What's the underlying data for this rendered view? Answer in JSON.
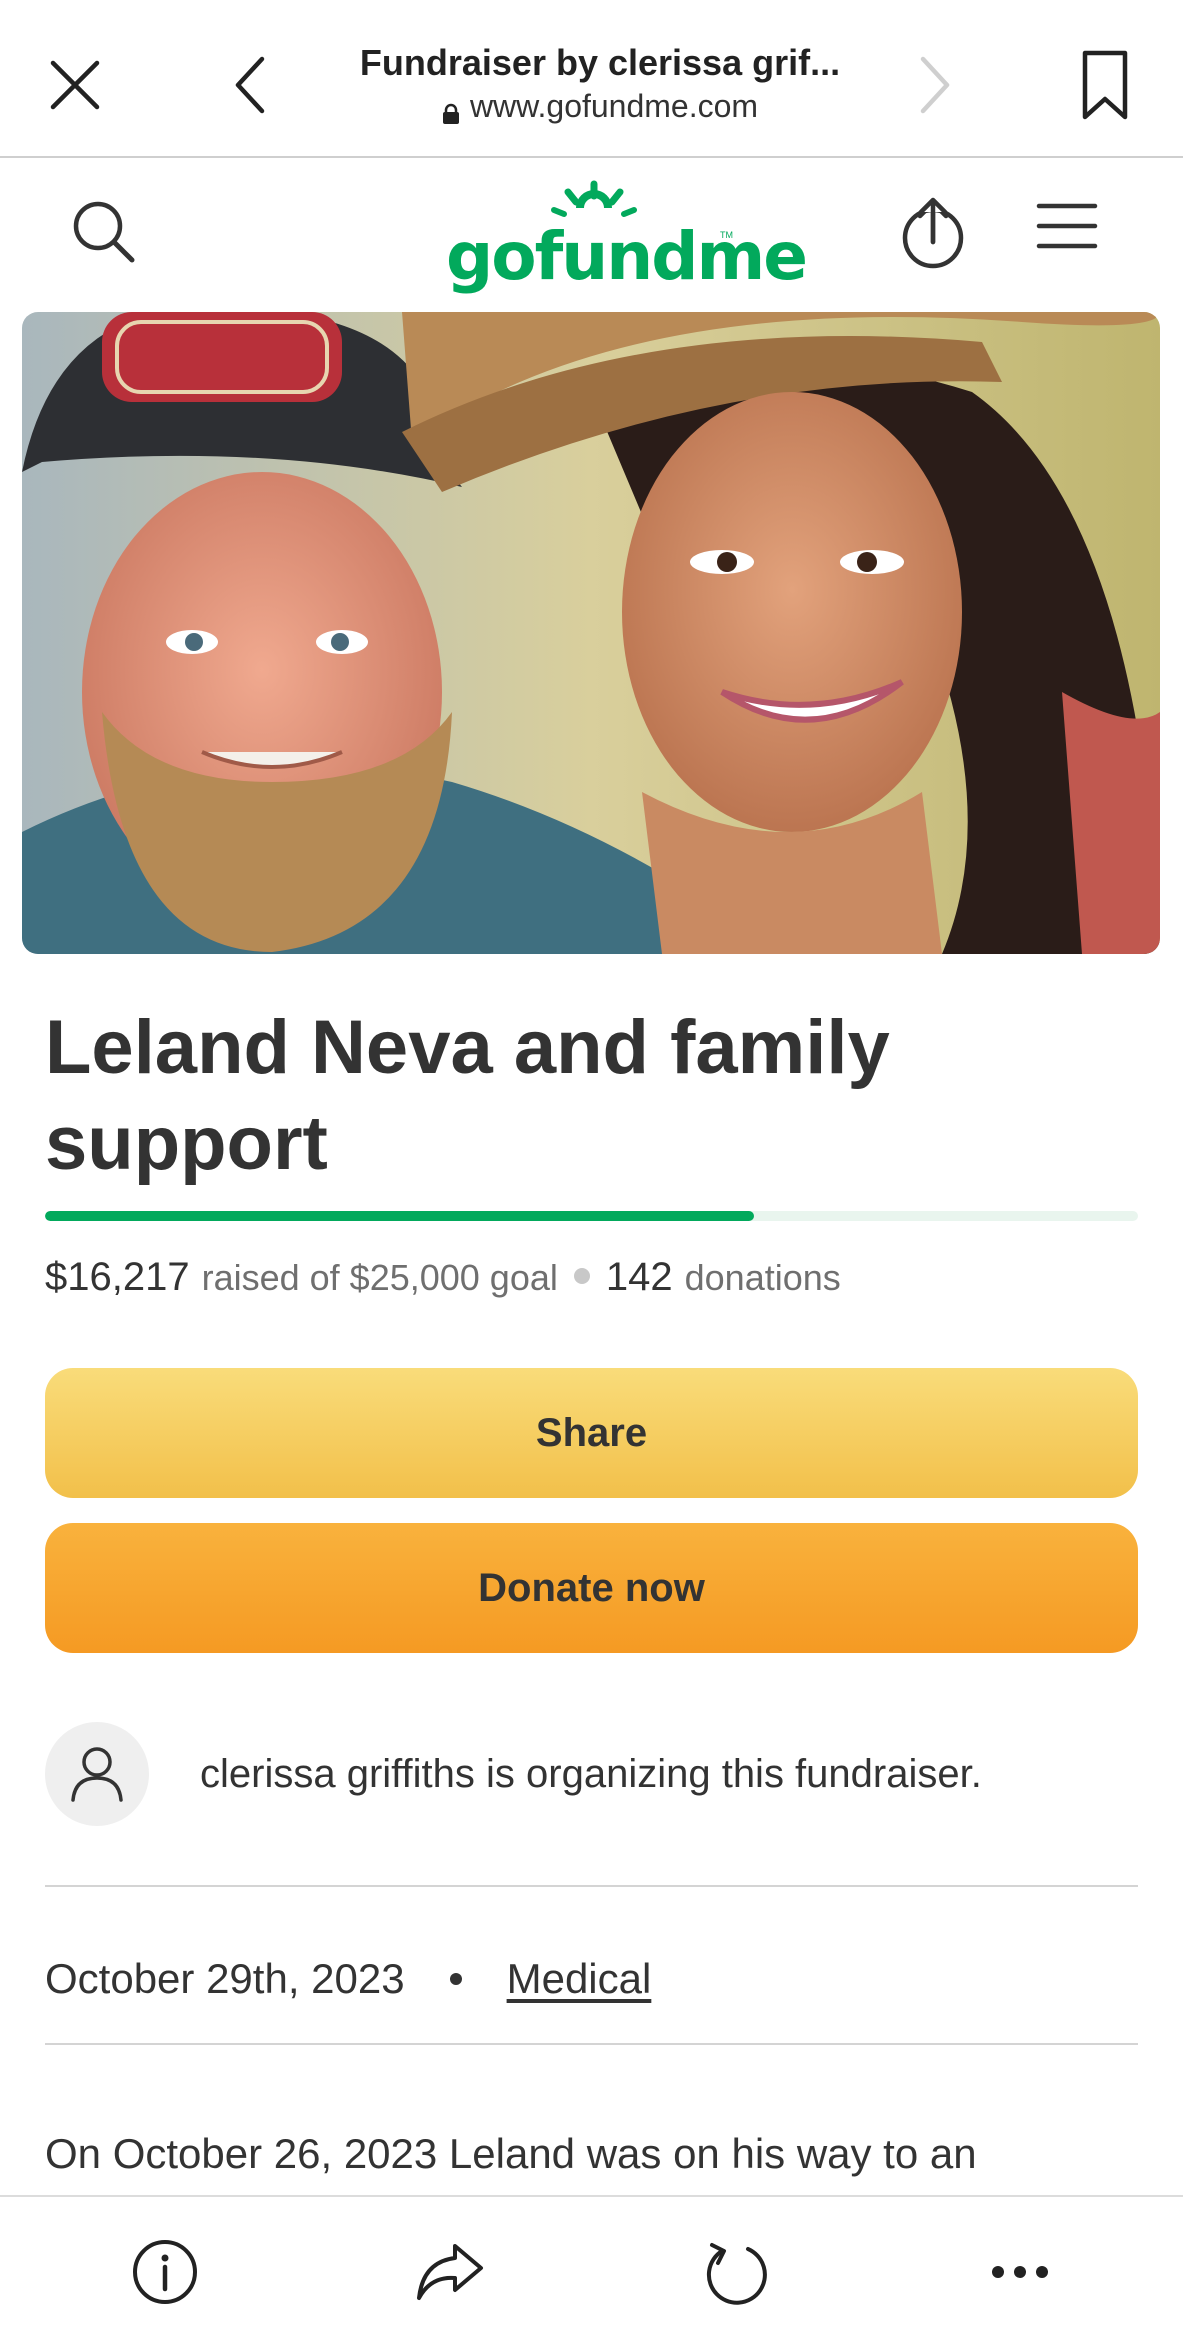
{
  "browser": {
    "page_title": "Fundraiser by clerissa grif...",
    "url": "www.gofundme.com",
    "icons": [
      "close-icon",
      "back-icon",
      "forward-icon",
      "bookmark-icon",
      "lock-icon"
    ]
  },
  "header": {
    "logo_text": "gofundme",
    "logo_trademark": "TM",
    "icons": [
      "search-icon",
      "share-upload-icon",
      "menu-icon"
    ]
  },
  "fundraiser": {
    "title": "Leland Neva and family support",
    "progress_fraction": 0.649,
    "raised": "$16,217",
    "raised_label": "raised of $25,000 goal",
    "donations_count": "142",
    "donations_label": "donations"
  },
  "buttons": {
    "share": "Share",
    "donate": "Donate now"
  },
  "organizer": {
    "text": "clerissa griffiths is organizing this fundraiser.",
    "icon": "user-icon"
  },
  "meta": {
    "date": "October 29th, 2023",
    "category": "Medical"
  },
  "story": {
    "first_line": "On October 26, 2023 Leland was on his way to an"
  },
  "toolbar": {
    "icons": [
      "info-icon",
      "share-icon",
      "reload-icon",
      "more-icon"
    ]
  },
  "colors": {
    "brand_green": "#02a95c",
    "share_button": "#f6cb5a",
    "donate_button": "#f7a530",
    "text": "#333333"
  }
}
